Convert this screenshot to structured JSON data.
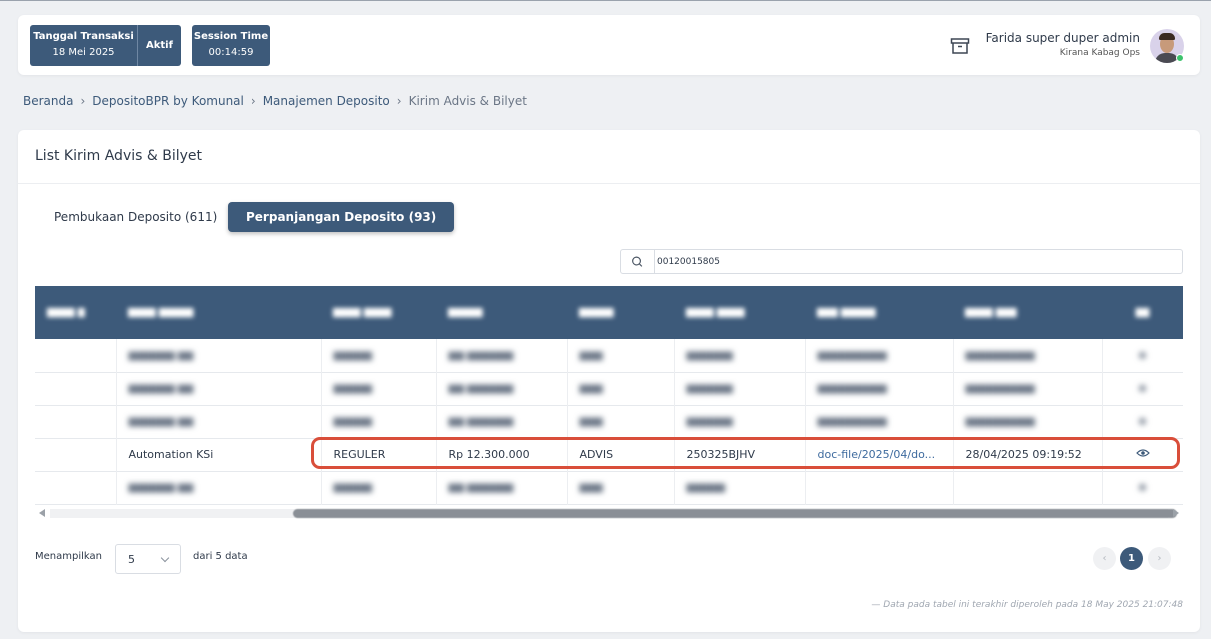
{
  "topbar": {
    "transaction_date_label": "Tanggal Transaksi",
    "transaction_date": "18 Mei 2025",
    "status": "Aktif",
    "session_label": "Session Time",
    "session_time": "00:14:59",
    "user_name": "Farida super duper admin",
    "user_role": "Kirana Kabag Ops"
  },
  "breadcrumb": {
    "items": [
      "Beranda",
      "DepositoBPR by Komunal",
      "Manajemen Deposito"
    ],
    "current": "Kirim Advis & Bilyet"
  },
  "card": {
    "title": "List Kirim Advis & Bilyet",
    "tabs": [
      {
        "label": "Pembukaan Deposito (611)",
        "active": false
      },
      {
        "label": "Perpanjangan Deposito (93)",
        "active": true
      }
    ],
    "search_value": "00120015805"
  },
  "table": {
    "highlighted_row": {
      "nama_nasabah": "Automation KSi",
      "jenis_deposito": "REGULER",
      "nominal": "Rp 12.300.000",
      "dokumen": "ADVIS",
      "nomor_dokumen": "250325BJHV",
      "file_dokumen": "doc-file/2025/04/do...",
      "waktu": "28/04/2025 09:19:52"
    }
  },
  "footer": {
    "show_label": "Menampilkan",
    "page_size": "5",
    "of_label": "dari 5 data",
    "current_page": "1",
    "updated_note": "— Data pada tabel ini terakhir diperoleh pada 18 May 2025 21:07:48"
  },
  "colors": {
    "primary": "#3d5a7a",
    "highlight": "#d94e3a",
    "online": "#3cc26c"
  }
}
